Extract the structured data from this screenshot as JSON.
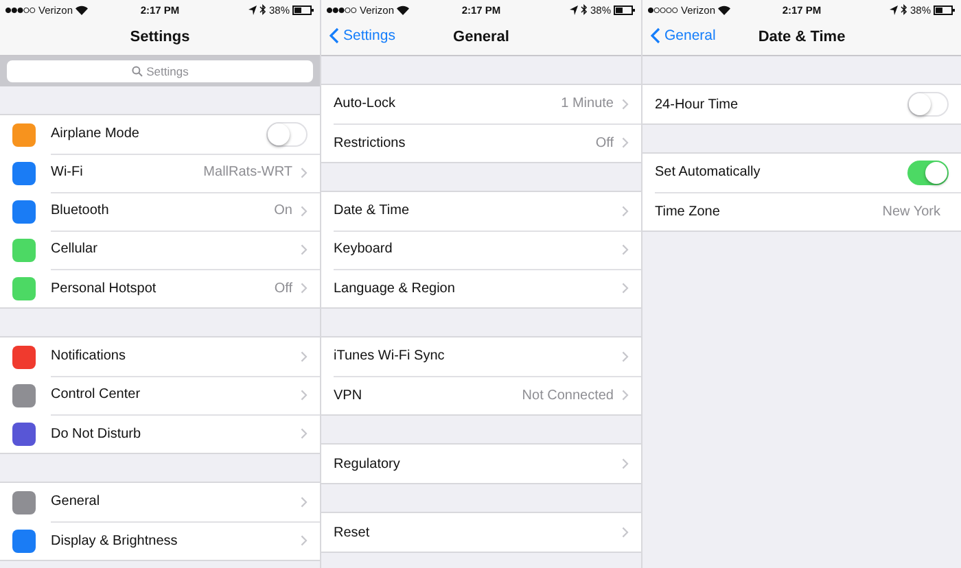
{
  "screens": [
    {
      "status": {
        "carrier": "Verizon",
        "time": "2:17 PM",
        "battery": "38%"
      },
      "nav": {
        "title": "Settings"
      },
      "search": {
        "placeholder": "Settings"
      },
      "groups": [
        {
          "rows": [
            {
              "kind": "toggle",
              "label": "Airplane Mode",
              "on": false,
              "color": "#f7931e"
            },
            {
              "kind": "link",
              "label": "Wi-Fi",
              "value": "MallRats-WRT",
              "color": "#1a7cf5"
            },
            {
              "kind": "link",
              "label": "Bluetooth",
              "value": "On",
              "color": "#1a7cf5"
            },
            {
              "kind": "link",
              "label": "Cellular",
              "color": "#4cd964"
            },
            {
              "kind": "link",
              "label": "Personal Hotspot",
              "value": "Off",
              "color": "#4cd964"
            }
          ]
        },
        {
          "rows": [
            {
              "kind": "link",
              "label": "Notifications",
              "color": "#f03a2e"
            },
            {
              "kind": "link",
              "label": "Control Center",
              "color": "#8e8e93"
            },
            {
              "kind": "link",
              "label": "Do Not Disturb",
              "color": "#5856d6"
            }
          ]
        },
        {
          "rows": [
            {
              "kind": "link",
              "label": "General",
              "color": "#8e8e93"
            },
            {
              "kind": "link",
              "label": "Display & Brightness",
              "color": "#1a7cf5"
            }
          ]
        }
      ]
    },
    {
      "status": {
        "carrier": "Verizon",
        "time": "2:17 PM",
        "battery": "38%"
      },
      "nav": {
        "back": "Settings",
        "title": "General"
      },
      "groups": [
        {
          "rows": [
            {
              "kind": "link",
              "label": "Auto-Lock",
              "value": "1 Minute"
            },
            {
              "kind": "link",
              "label": "Restrictions",
              "value": "Off"
            }
          ]
        },
        {
          "rows": [
            {
              "kind": "link",
              "label": "Date & Time"
            },
            {
              "kind": "link",
              "label": "Keyboard"
            },
            {
              "kind": "link",
              "label": "Language & Region"
            }
          ]
        },
        {
          "rows": [
            {
              "kind": "link",
              "label": "iTunes Wi-Fi Sync"
            },
            {
              "kind": "link",
              "label": "VPN",
              "value": "Not Connected"
            }
          ]
        },
        {
          "rows": [
            {
              "kind": "link",
              "label": "Regulatory"
            }
          ]
        },
        {
          "rows": [
            {
              "kind": "link",
              "label": "Reset"
            }
          ]
        }
      ]
    },
    {
      "status": {
        "carrier": "Verizon",
        "time": "2:17 PM",
        "battery": "38%"
      },
      "nav": {
        "back": "General",
        "title": "Date & Time"
      },
      "groups": [
        {
          "rows": [
            {
              "kind": "toggle",
              "label": "24-Hour Time",
              "on": false
            }
          ]
        },
        {
          "rows": [
            {
              "kind": "toggle",
              "label": "Set Automatically",
              "on": true
            },
            {
              "kind": "value",
              "label": "Time Zone",
              "value": "New York"
            }
          ]
        }
      ]
    }
  ]
}
